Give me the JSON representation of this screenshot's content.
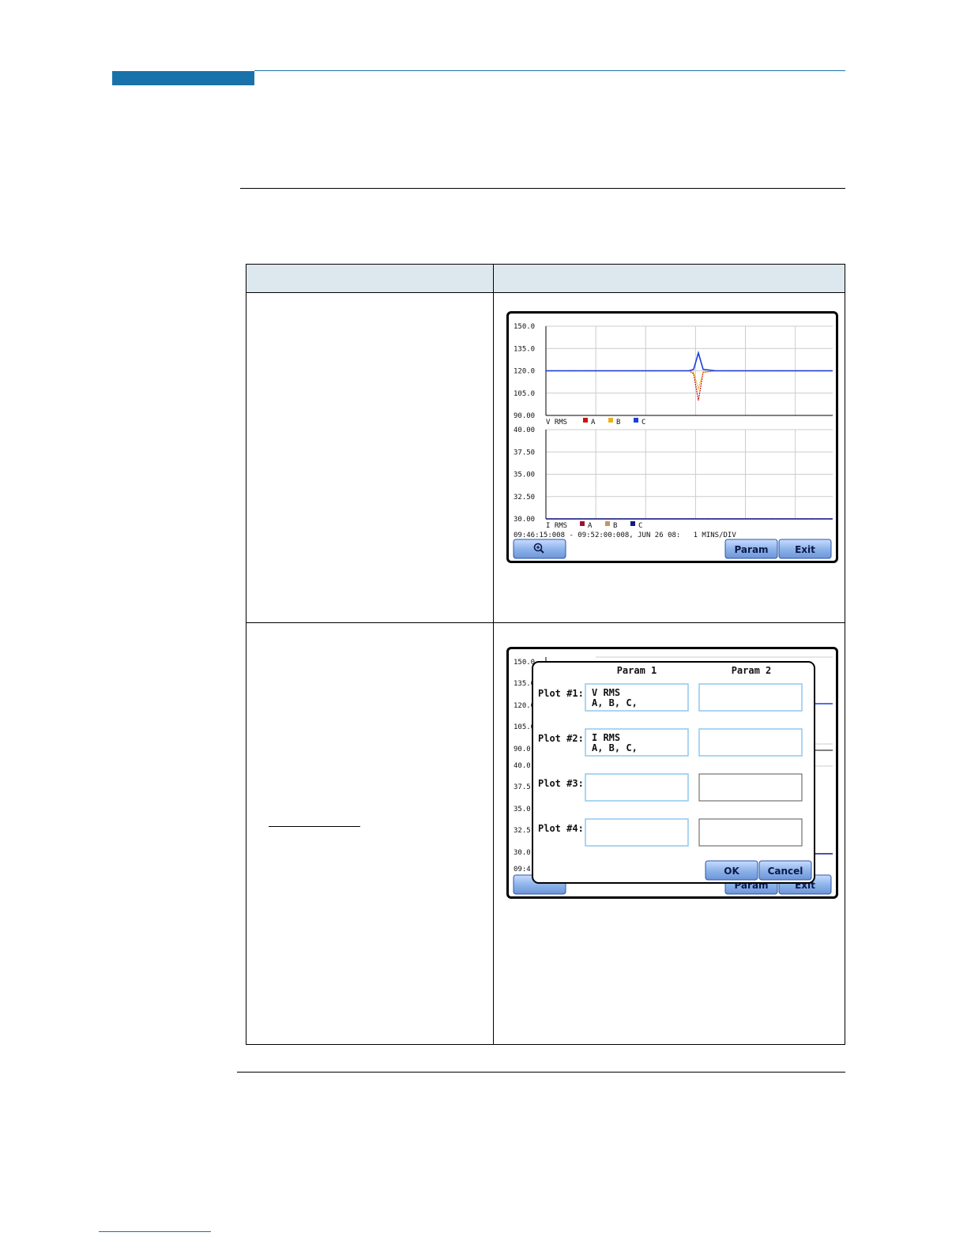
{
  "colors": {
    "header_bar": "#1a72ab",
    "table_header": "#dde7ee",
    "button_blue": "#8fb4ea",
    "phase_a": "#d01010",
    "phase_b": "#e8b21a",
    "phase_c": "#1a3ee0",
    "current_b": "#c8945a",
    "current_c": "#101a8a"
  },
  "screen1": {
    "top_plot": {
      "y_ticks": [
        "150.0",
        "135.0",
        "120.0",
        "105.0",
        "90.00"
      ],
      "legend": {
        "label": "V RMS",
        "a": "A",
        "b": "B",
        "c": "C"
      }
    },
    "bottom_plot": {
      "y_ticks": [
        "40.00",
        "37.50",
        "35.00",
        "32.50",
        "30.00"
      ],
      "legend": {
        "label": "I RMS",
        "a": "A",
        "b": "B",
        "c": "C"
      }
    },
    "status_line": "09:46:15:008 - 09:52:00:008, JUN 26 08:   1 MINS/DIV",
    "buttons": {
      "zoom_icon": "magnify-plus-icon",
      "param": "Param",
      "exit": "Exit"
    }
  },
  "screen2": {
    "bg_ticks": [
      "150.0",
      "135.0",
      "120.0",
      "105.0",
      "90.0",
      "40.0",
      "37.5",
      "35.0",
      "32.5",
      "30.0",
      "09:4"
    ],
    "bg_buttons": {
      "param": "Param",
      "exit": "Exit"
    },
    "dialog": {
      "col1_header": "Param 1",
      "col2_header": "Param 2",
      "rows": [
        {
          "label": "Plot #1:",
          "param1_line1": "V RMS",
          "param1_line2": "A, B, C,"
        },
        {
          "label": "Plot #2:",
          "param1_line1": "I RMS",
          "param1_line2": "A, B, C,"
        },
        {
          "label": "Plot #3:",
          "param1_line1": "",
          "param1_line2": ""
        },
        {
          "label": "Plot #4:",
          "param1_line1": "",
          "param1_line2": ""
        }
      ],
      "ok": "OK",
      "cancel": "Cancel"
    }
  },
  "chart_data": [
    {
      "type": "line",
      "ylim": [
        90,
        150
      ],
      "yticks": [
        150,
        135,
        120,
        105,
        90
      ],
      "ylabel": "",
      "series": [
        {
          "name": "A",
          "values": [
            120,
            120,
            120,
            120,
            118,
            100,
            119,
            120,
            120
          ]
        },
        {
          "name": "B",
          "values": [
            120,
            120,
            120,
            120,
            119,
            108,
            119,
            120,
            120
          ]
        },
        {
          "name": "C",
          "values": [
            120,
            120,
            120,
            120,
            121,
            132,
            121,
            120,
            120
          ]
        }
      ],
      "legend": [
        "V RMS",
        "A",
        "B",
        "C"
      ]
    },
    {
      "type": "line",
      "ylim": [
        30,
        40
      ],
      "yticks": [
        40,
        37.5,
        35,
        32.5,
        30
      ],
      "series": [
        {
          "name": "A",
          "values": [
            30,
            30,
            30,
            30,
            30,
            30,
            30,
            30,
            30
          ]
        },
        {
          "name": "B",
          "values": [
            30,
            30,
            30,
            30,
            30,
            30,
            30,
            30,
            30
          ]
        },
        {
          "name": "C",
          "values": [
            30,
            30,
            30,
            30,
            30,
            30,
            30,
            30,
            30
          ]
        }
      ],
      "legend": [
        "I RMS",
        "A",
        "B",
        "C"
      ]
    }
  ]
}
